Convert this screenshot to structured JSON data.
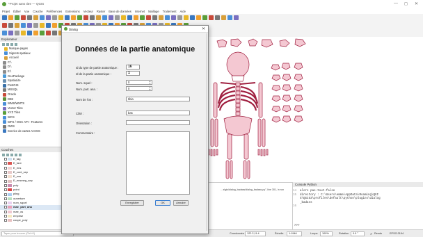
{
  "window": {
    "title": "*Projet sans titre — QGIS",
    "controls": [
      "—",
      "◻",
      "✕"
    ]
  },
  "menu": [
    "Projet",
    "Éditer",
    "Vue",
    "Couche",
    "Préférences",
    "Extensions",
    "Vecteur",
    "Raster",
    "Base de données",
    "Internet",
    "Maillage",
    "Traitement",
    "Aide"
  ],
  "browser": {
    "title": "Explorateur",
    "items": [
      {
        "label": "Marque-pages",
        "icon": "star-icon",
        "color": "#e8b829"
      },
      {
        "label": "Signets spatiaux",
        "icon": "bookmark-icon",
        "color": "#4a8fd8"
      },
      {
        "label": "Accueil",
        "icon": "home-icon",
        "color": "#d8a03a"
      },
      {
        "label": "C:\\",
        "icon": "drive-icon",
        "color": "#8c8c8c"
      },
      {
        "label": "D:\\",
        "icon": "drive-icon",
        "color": "#8c8c8c"
      },
      {
        "label": "E:\\",
        "icon": "drive-icon",
        "color": "#8c8c8c"
      },
      {
        "label": "GeoPackage",
        "icon": "geopackage-icon",
        "color": "#4a9ad8"
      },
      {
        "label": "SpatiaLite",
        "icon": "spatialite-icon",
        "color": "#6a8fb0"
      },
      {
        "label": "PostGIS",
        "icon": "postgis-icon",
        "color": "#3870a8"
      },
      {
        "label": "MSSQL",
        "icon": "mssql-icon",
        "color": "#777777"
      },
      {
        "label": "Oracle",
        "icon": "oracle-icon",
        "color": "#c84a3a"
      },
      {
        "label": "DB2",
        "icon": "db2-icon",
        "color": "#5b8f3a"
      },
      {
        "label": "WMS/WMTS",
        "icon": "wms-icon",
        "color": "#4a8fd8"
      },
      {
        "label": "Vector Tiles",
        "icon": "vector-tiles-icon",
        "color": "#7a6fc0"
      },
      {
        "label": "XYZ Tiles",
        "icon": "xyz-tiles-icon",
        "color": "#5a9e3a"
      },
      {
        "label": "WCS",
        "icon": "wcs-icon",
        "color": "#4a8fd8"
      },
      {
        "label": "WFS / OGC API - Features",
        "icon": "wfs-icon",
        "color": "#4a8fd8"
      },
      {
        "label": "OWS",
        "icon": "ows-icon",
        "color": "#777777"
      },
      {
        "label": "Service de cartes ArcGIS",
        "icon": "arcgis-icon",
        "color": "#3a78c0"
      }
    ]
  },
  "layers": {
    "title": "Couches",
    "items": [
      {
        "label": "E_tag",
        "color": "#cde0f2"
      },
      {
        "label": "E_fant",
        "color": "#d9534f"
      },
      {
        "label": "E_ens",
        "color": "#f0d0d0"
      },
      {
        "label": "E_cont_sep",
        "color": "#e8c8c8"
      },
      {
        "label": "E_oss",
        "color": "#f5e0d0"
      },
      {
        "label": "E_ensmeg_sep",
        "color": "#e0c0c0"
      },
      {
        "label": "poly",
        "color": "#c88ab0"
      },
      {
        "label": "point",
        "color": "#d44"
      },
      {
        "label": "pling",
        "color": "#aaccee"
      },
      {
        "label": "ouverture",
        "color": "#b8e0c0"
      },
      {
        "label": "num_squel",
        "color": "#e8d0f0"
      },
      {
        "label": "mae_part_ana",
        "color": "#e9a0b8",
        "selected": true
      },
      {
        "label": "mae_os",
        "color": "#f0c8d0"
      },
      {
        "label": "emprise",
        "color": "#f5e8c0"
      },
      {
        "label": "coupe_poly",
        "color": "#e8c0c0"
      }
    ]
  },
  "console": {
    "title": "Console Python",
    "lines": [
      {
        "num": "14",
        "text": "alors pas-tout-false"
      },
      {
        "num": "15",
        "text": "directory : C:\\Users\\emma\\AppData\\Roaming\\QGI"
      },
      {
        "num": "",
        "text": "S\\QGIS3\\profiles\\default\\python\\plugins\\dialog"
      },
      {
        "num": "",
        "text": "_badass"
      },
      {
        "num": "16",
        "text": ""
      }
    ],
    "prompt": ">>>"
  },
  "message": {
    "text": "…s\\gis\\dialog_badass\\dialog_badass.py\", line 301, in run"
  },
  "status": {
    "search_placeholder": "Taper pour trouver (Ctrl+K)",
    "coord_label": "Coordonnée",
    "coord_value": "122.2,11.4",
    "scale_label": "Échelle",
    "scale_value": "1:1946",
    "magnifier_label": "Loupe",
    "magnifier_value": "100%",
    "rotation_label": "Rotation",
    "rotation_value": "0.0 °",
    "render_label": "Rendu",
    "crs": "EPSG:3194"
  },
  "dialog": {
    "window_title": "Dialog",
    "heading": "Données de la partie anatomique",
    "fields": [
      {
        "label": "Id du type de partie anatomique :",
        "value": "16",
        "kind": "bold"
      },
      {
        "label": "Id de la partie anatomique :",
        "value": "1",
        "kind": "bold"
      },
      {
        "label": "Num. squel :",
        "value": "0",
        "kind": "spin"
      },
      {
        "label": "Num. part. ana. :",
        "value": "0",
        "kind": "spin"
      },
      {
        "label": "Nom de l'os :",
        "value": "tibia",
        "kind": "text"
      },
      {
        "label": "Côté :",
        "value": "bas",
        "kind": "text"
      },
      {
        "label": "Orientation :",
        "value": "",
        "kind": "text"
      }
    ],
    "comment_label": "Commentaire :",
    "buttons": {
      "save": "Enregistrer",
      "ok": "OK",
      "cancel": "Annuler"
    }
  }
}
